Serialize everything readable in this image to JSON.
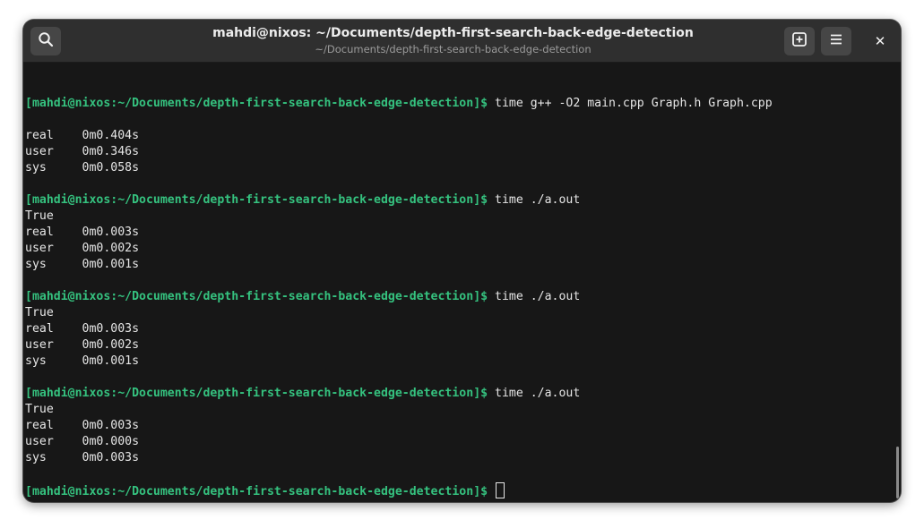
{
  "window": {
    "title": "mahdi@nixos: ~/Documents/depth-first-search-back-edge-detection",
    "subtitle": "~/Documents/depth-first-search-back-edge-detection"
  },
  "toolbar": {
    "search_icon": "search-icon",
    "new_tab_icon": "new-tab-icon",
    "menu_icon": "hamburger-menu-icon",
    "close_label": "✕"
  },
  "colors": {
    "prompt": "#35c27f",
    "background": "#171717",
    "text": "#e6e6e6",
    "headerbar": "#2f2f2f"
  },
  "terminal": {
    "prompt": "[mahdi@nixos:~/Documents/depth-first-search-back-edge-detection]$",
    "lines": [
      {
        "type": "blank",
        "text": ""
      },
      {
        "type": "cmd",
        "text": " time g++ -O2 main.cpp Graph.h Graph.cpp"
      },
      {
        "type": "blank",
        "text": ""
      },
      {
        "type": "out",
        "text": "real    0m0.404s"
      },
      {
        "type": "out",
        "text": "user    0m0.346s"
      },
      {
        "type": "out",
        "text": "sys     0m0.058s"
      },
      {
        "type": "blank",
        "text": ""
      },
      {
        "type": "cmd",
        "text": " time ./a.out"
      },
      {
        "type": "out",
        "text": "True"
      },
      {
        "type": "out",
        "text": "real    0m0.003s"
      },
      {
        "type": "out",
        "text": "user    0m0.002s"
      },
      {
        "type": "out",
        "text": "sys     0m0.001s"
      },
      {
        "type": "blank",
        "text": ""
      },
      {
        "type": "cmd",
        "text": " time ./a.out"
      },
      {
        "type": "out",
        "text": "True"
      },
      {
        "type": "out",
        "text": "real    0m0.003s"
      },
      {
        "type": "out",
        "text": "user    0m0.002s"
      },
      {
        "type": "out",
        "text": "sys     0m0.001s"
      },
      {
        "type": "blank",
        "text": ""
      },
      {
        "type": "cmd",
        "text": " time ./a.out"
      },
      {
        "type": "out",
        "text": "True"
      },
      {
        "type": "out",
        "text": "real    0m0.003s"
      },
      {
        "type": "out",
        "text": "user    0m0.000s"
      },
      {
        "type": "out",
        "text": "sys     0m0.003s"
      },
      {
        "type": "blank",
        "text": ""
      },
      {
        "type": "cursor",
        "text": " "
      }
    ]
  }
}
